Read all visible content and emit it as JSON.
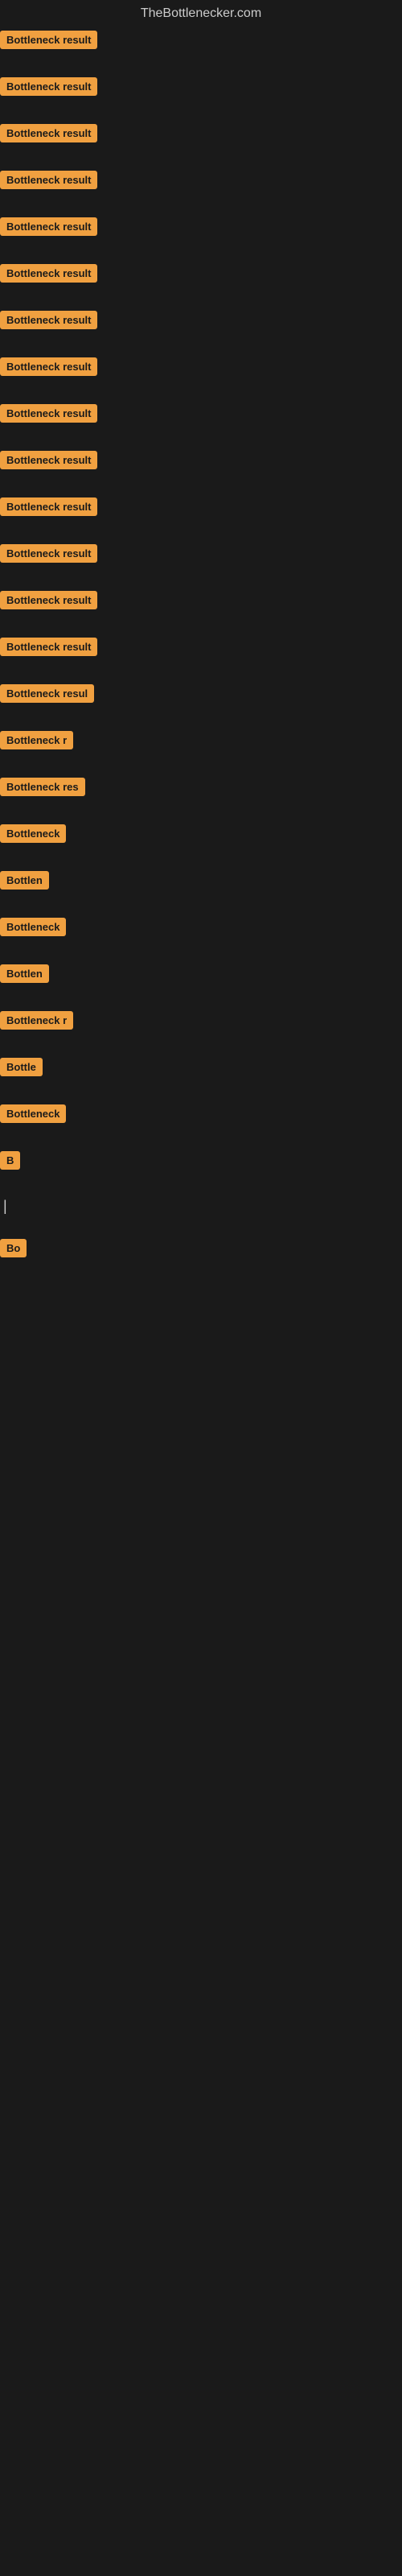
{
  "site": {
    "title": "TheBottlenecker.com"
  },
  "results": [
    {
      "id": 1,
      "label": "Bottleneck result",
      "width": 120
    },
    {
      "id": 2,
      "label": "Bottleneck result",
      "width": 120
    },
    {
      "id": 3,
      "label": "Bottleneck result",
      "width": 120
    },
    {
      "id": 4,
      "label": "Bottleneck result",
      "width": 120
    },
    {
      "id": 5,
      "label": "Bottleneck result",
      "width": 120
    },
    {
      "id": 6,
      "label": "Bottleneck result",
      "width": 120
    },
    {
      "id": 7,
      "label": "Bottleneck result",
      "width": 120
    },
    {
      "id": 8,
      "label": "Bottleneck result",
      "width": 120
    },
    {
      "id": 9,
      "label": "Bottleneck result",
      "width": 120
    },
    {
      "id": 10,
      "label": "Bottleneck result",
      "width": 120
    },
    {
      "id": 11,
      "label": "Bottleneck result",
      "width": 120
    },
    {
      "id": 12,
      "label": "Bottleneck result",
      "width": 120
    },
    {
      "id": 13,
      "label": "Bottleneck result",
      "width": 120
    },
    {
      "id": 14,
      "label": "Bottleneck result",
      "width": 120
    },
    {
      "id": 15,
      "label": "Bottleneck resul",
      "width": 110
    },
    {
      "id": 16,
      "label": "Bottleneck r",
      "width": 90
    },
    {
      "id": 17,
      "label": "Bottleneck res",
      "width": 100
    },
    {
      "id": 18,
      "label": "Bottleneck",
      "width": 80
    },
    {
      "id": 19,
      "label": "Bottlen",
      "width": 65
    },
    {
      "id": 20,
      "label": "Bottleneck",
      "width": 80
    },
    {
      "id": 21,
      "label": "Bottlen",
      "width": 65
    },
    {
      "id": 22,
      "label": "Bottleneck r",
      "width": 90
    },
    {
      "id": 23,
      "label": "Bottle",
      "width": 55
    },
    {
      "id": 24,
      "label": "Bottleneck",
      "width": 80
    },
    {
      "id": 25,
      "label": "B",
      "width": 20
    },
    {
      "id": 26,
      "label": "|",
      "width": 12
    },
    {
      "id": 27,
      "label": "",
      "width": 0
    },
    {
      "id": 28,
      "label": "",
      "width": 0
    },
    {
      "id": 29,
      "label": "",
      "width": 0
    },
    {
      "id": 30,
      "label": "Bo",
      "width": 25
    },
    {
      "id": 31,
      "label": "",
      "width": 0
    },
    {
      "id": 32,
      "label": "",
      "width": 0
    },
    {
      "id": 33,
      "label": "",
      "width": 0
    },
    {
      "id": 34,
      "label": "",
      "width": 0
    }
  ]
}
